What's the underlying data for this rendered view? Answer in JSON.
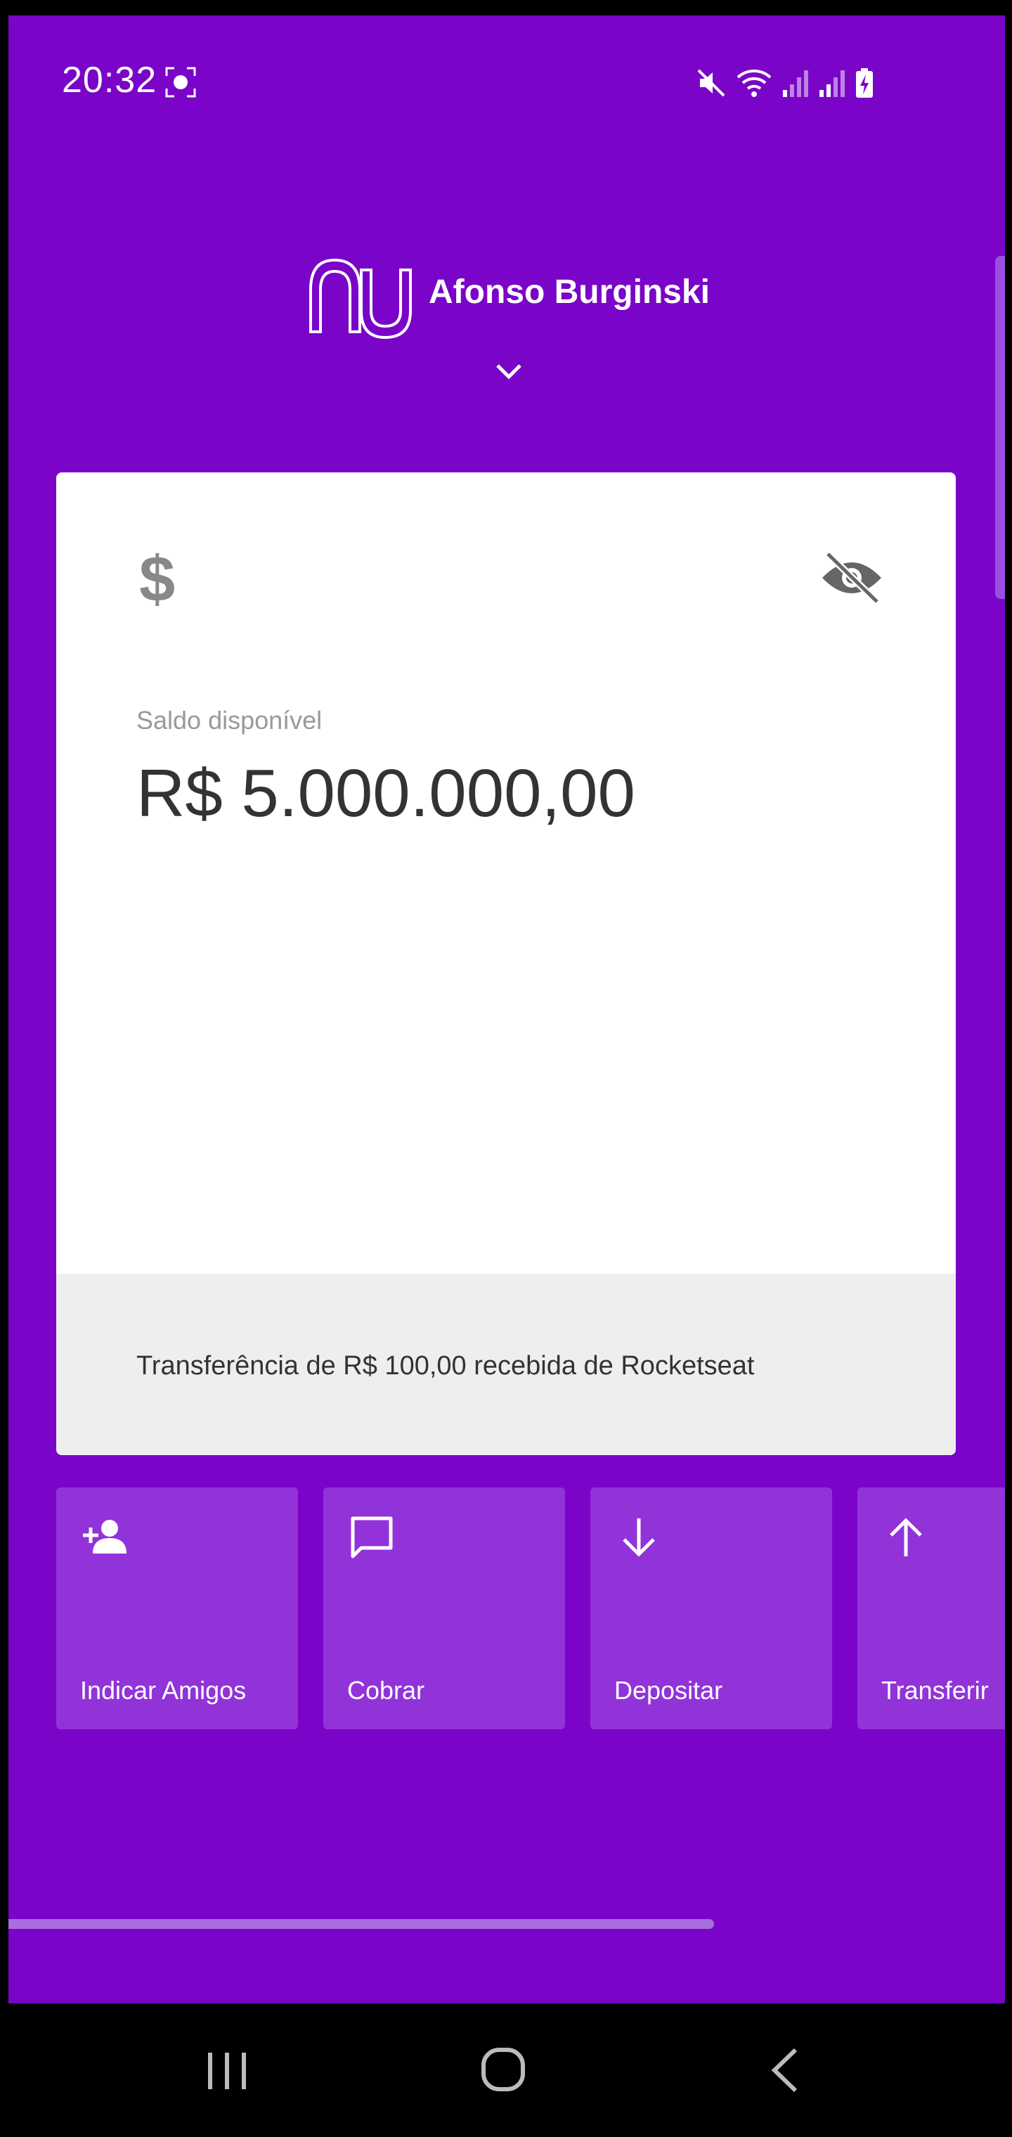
{
  "status_bar": {
    "time": "20:32"
  },
  "header": {
    "brand_icon": "nubank-logo",
    "user_name": "Afonso Burginski",
    "chevron_icon": "chevron-down-icon"
  },
  "card": {
    "dollar_symbol": "$",
    "balance_label": "Saldo disponível",
    "balance_value": "R$ 5.000.000,00",
    "visibility_icon": "eye-off-icon",
    "footer_text": "Transferência de R$ 100,00 recebida de Rocketseat"
  },
  "actions": [
    {
      "label": "Indicar Amigos",
      "icon": "person-add-icon"
    },
    {
      "label": "Cobrar",
      "icon": "chat-bubble-icon"
    },
    {
      "label": "Depositar",
      "icon": "arrow-down-icon"
    },
    {
      "label": "Transferir",
      "icon": "arrow-up-icon"
    }
  ],
  "colors": {
    "background": "#7a05c8",
    "action_tile": "#9233da",
    "card": "#ffffff",
    "card_footer": "#eeeeee"
  }
}
